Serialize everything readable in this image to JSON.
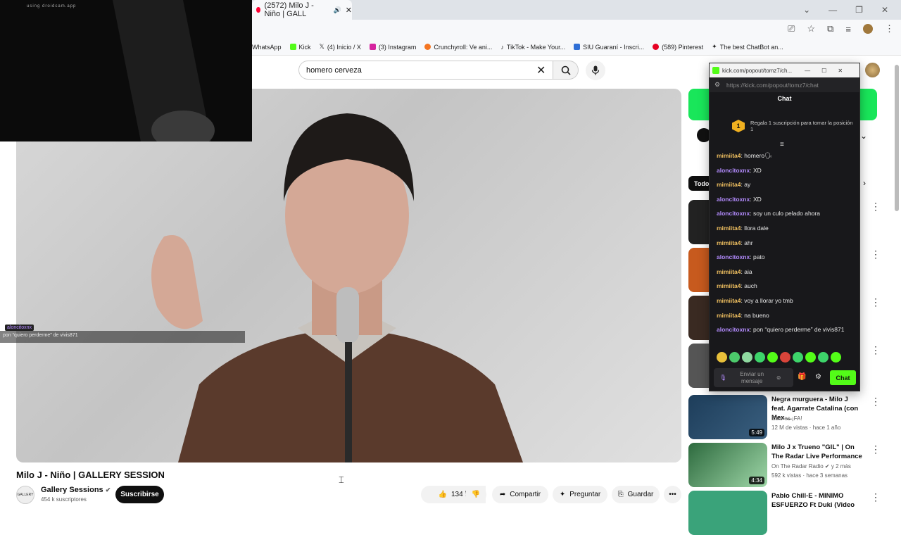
{
  "browser": {
    "tab_title": "(2572) Milo J - Niño | GALL",
    "bookmarks": [
      "WhatsApp",
      "Kick",
      "(4) Inicio / X",
      "(3) Instagram",
      "Crunchyroll: Ve ani...",
      "TikTok - Make Your...",
      "SIU Guaraní - Inscri...",
      "(589) Pinterest",
      "The best ChatBot an..."
    ]
  },
  "webcam": {
    "watermark": "using droidcam.app"
  },
  "search": {
    "query": "homero cerveza"
  },
  "video": {
    "title": "Milo J - Niño | GALLERY SESSION",
    "channel": "Gallery Sessions",
    "channel_avatar_text": "GALLERY",
    "subscribers": "454 k suscriptores",
    "subscribe_label": "Suscribirse",
    "likes": "134 k",
    "share_label": "Compartir",
    "ask_label": "Preguntar",
    "save_label": "Guardar",
    "overlay_user": "aloncitoxnx",
    "overlay_message": "pon “quiero perderme” de vivis871"
  },
  "sidebar": {
    "chip_all": "Todo",
    "items": [
      {
        "title": "Negra murguera - Milo J feat. Agarrate Catalina (con Mex ...",
        "channel": "Esto es ¡FA!",
        "meta": "12 M de vistas · hace 1 año",
        "duration": "5:49"
      },
      {
        "title": "Milo J x Trueno \"GIL\" | On The Radar Live Performance",
        "channel": "On The Radar Radio",
        "meta": "592 k vistas · hace 3 semanas",
        "age": "y 2 más",
        "duration": "4:34"
      },
      {
        "title": "Pablo Chill-E - MINIMO ESFUERZO Ft Duki (Video",
        "channel": "",
        "meta": ""
      }
    ]
  },
  "kick": {
    "window_title": "kick.com/popout/tomz7/ch...",
    "url": "https://kick.com/popout/tomz7/chat",
    "chat_title": "Chat",
    "promo_rank": "1",
    "promo_text": "Regala 1 suscripción para tomar la posición 1",
    "messages": [
      {
        "user": "mimiita4",
        "text": "homero🗣",
        "color": "y"
      },
      {
        "user": "aloncitoxnx",
        "text": "XD",
        "color": "p"
      },
      {
        "user": "mimiita4",
        "text": "ay",
        "color": "y"
      },
      {
        "user": "aloncitoxnx",
        "text": "XD",
        "color": "p"
      },
      {
        "user": "aloncitoxnx",
        "text": "soy un culo pelado ahora",
        "color": "p"
      },
      {
        "user": "mimiita4",
        "text": "llora dale",
        "color": "y"
      },
      {
        "user": "mimiita4",
        "text": "ahr",
        "color": "y"
      },
      {
        "user": "aloncitoxnx",
        "text": "pato",
        "color": "p"
      },
      {
        "user": "mimiita4",
        "text": "aia",
        "color": "y"
      },
      {
        "user": "mimiita4",
        "text": "auch",
        "color": "y"
      },
      {
        "user": "mimiita4",
        "text": "voy a llorar yo tmb",
        "color": "y"
      },
      {
        "user": "mimiita4",
        "text": "na bueno",
        "color": "y"
      },
      {
        "user": "aloncitoxnx",
        "text": "pon “quiero perderme” de vivis871",
        "color": "p"
      }
    ],
    "input_placeholder": "Enviar un mensaje",
    "send_label": "Chat"
  },
  "colors": {
    "kick_green": "#53fc18",
    "yt_red": "#ff0033",
    "user_yellow": "#f0c060",
    "user_purple": "#b48cff"
  }
}
